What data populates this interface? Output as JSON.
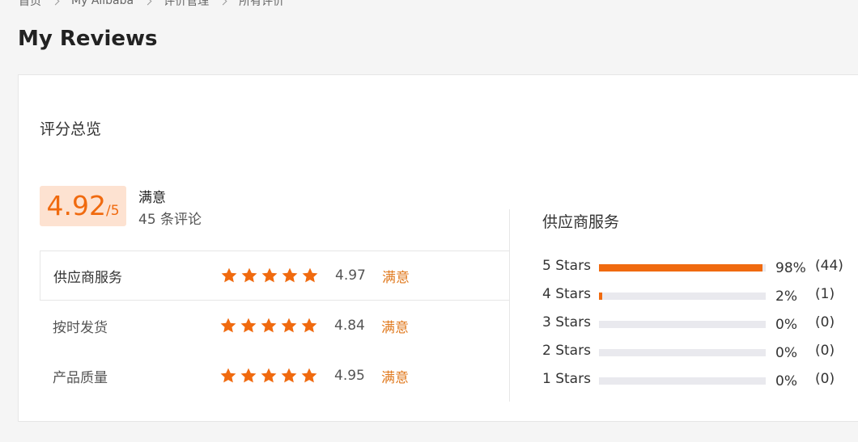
{
  "breadcrumb": [
    "首页",
    "My Alibaba",
    "评价管理",
    "所有评价"
  ],
  "page_title": "My Reviews",
  "overview": {
    "title": "评分总览",
    "score": "4.92",
    "score_max": "/5",
    "rating_word": "满意",
    "review_count": "45 条评论"
  },
  "ratings": [
    {
      "label": "供应商服务",
      "stars": 5,
      "score": "4.97",
      "word": "满意"
    },
    {
      "label": "按时发货",
      "stars": 5,
      "score": "4.84",
      "word": "满意"
    },
    {
      "label": "产品质量",
      "stars": 5,
      "score": "4.95",
      "word": "满意"
    }
  ],
  "distribution": {
    "title": "供应商服务",
    "rows": [
      {
        "label": "5  Stars",
        "percent": 98,
        "percent_text": "98%",
        "count": "(44)"
      },
      {
        "label": "4  Stars",
        "percent": 2,
        "percent_text": "2%",
        "count": "(1)"
      },
      {
        "label": "3  Stars",
        "percent": 0,
        "percent_text": "0%",
        "count": "(0)"
      },
      {
        "label": "2  Stars",
        "percent": 0,
        "percent_text": "0%",
        "count": "(0)"
      },
      {
        "label": "1  Stars",
        "percent": 0,
        "percent_text": "0%",
        "count": "(0)"
      }
    ]
  },
  "colors": {
    "accent": "#f06a0f",
    "rating_word": "#e07a1f",
    "badge_bg": "#fde2d1",
    "track": "#e9e9ee"
  }
}
